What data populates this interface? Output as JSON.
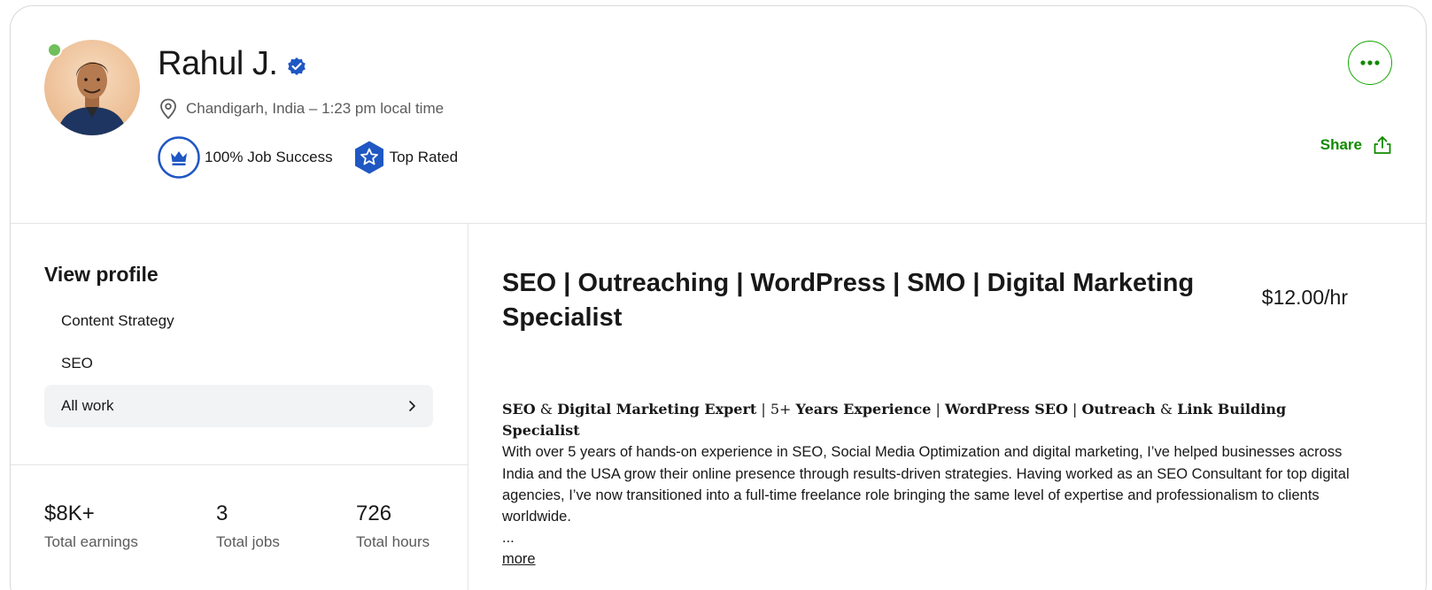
{
  "profile": {
    "name": "Rahul J.",
    "location": "Chandigarh, India – 1:23 pm local time",
    "badges": [
      {
        "label": "100% Job Success",
        "icon": "crown-icon"
      },
      {
        "label": "Top Rated",
        "icon": "star-badge-icon"
      }
    ],
    "share_label": "Share",
    "colors": {
      "brand_green": "#14a800",
      "verified_blue": "#1f57c3",
      "online": "#6fbf5a"
    }
  },
  "sidebar": {
    "title": "View profile",
    "items": [
      {
        "label": "Content Strategy"
      },
      {
        "label": "SEO"
      },
      {
        "label": "All work"
      }
    ],
    "stats": [
      {
        "value": "$8K+",
        "label": "Total earnings"
      },
      {
        "value": "3",
        "label": "Total jobs"
      },
      {
        "value": "726",
        "label": "Total hours"
      }
    ]
  },
  "main": {
    "title": "SEO | Outreaching | WordPress | SMO | Digital Marketing Specialist",
    "rate": "$12.00/hr",
    "headline": {
      "p1": "SEO",
      "s1": " & ",
      "p2": "Digital Marketing Expert",
      "s2": " | 5+ ",
      "p3": "Years Experience",
      "s3": " | ",
      "p4": "WordPress SEO",
      "s4": " | ",
      "p5": "Outreach",
      "s5": " & ",
      "p6": "Link Building Specialist"
    },
    "description": "With over 5 years of hands-on experience in SEO, Social Media Optimization and digital marketing, I’ve helped businesses across India and the USA grow their online presence through results-driven strategies. Having worked as an SEO Consultant for top digital agencies, I’ve now transitioned into a full-time freelance role bringing the same level of expertise and professionalism to clients worldwide.",
    "ellipsis": "...",
    "more_label": "more"
  }
}
